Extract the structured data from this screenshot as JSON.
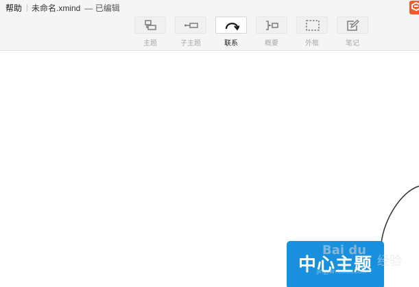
{
  "titlebar": {
    "help_menu": "帮助",
    "filename": "未命名.xmind",
    "status": "— 已编辑"
  },
  "brand": {
    "icon": "xmind-logo-icon",
    "color": "#f05a28"
  },
  "toolbar": {
    "tools": [
      {
        "label": "主题",
        "icon": "topic-icon",
        "active": false
      },
      {
        "label": "子主题",
        "icon": "subtopic-icon",
        "active": false
      },
      {
        "label": "联系",
        "icon": "relationship-icon",
        "active": true
      },
      {
        "label": "概要",
        "icon": "summary-icon",
        "active": false
      },
      {
        "label": "外框",
        "icon": "boundary-icon",
        "active": false
      },
      {
        "label": "笔记",
        "icon": "notes-icon",
        "active": false
      }
    ]
  },
  "canvas": {
    "central_topic": {
      "text": "中心主题",
      "color": "#1990dd"
    }
  },
  "watermark": {
    "brand": "Bai du",
    "suffix": "经验",
    "url": "jingyan.baidu.com"
  }
}
